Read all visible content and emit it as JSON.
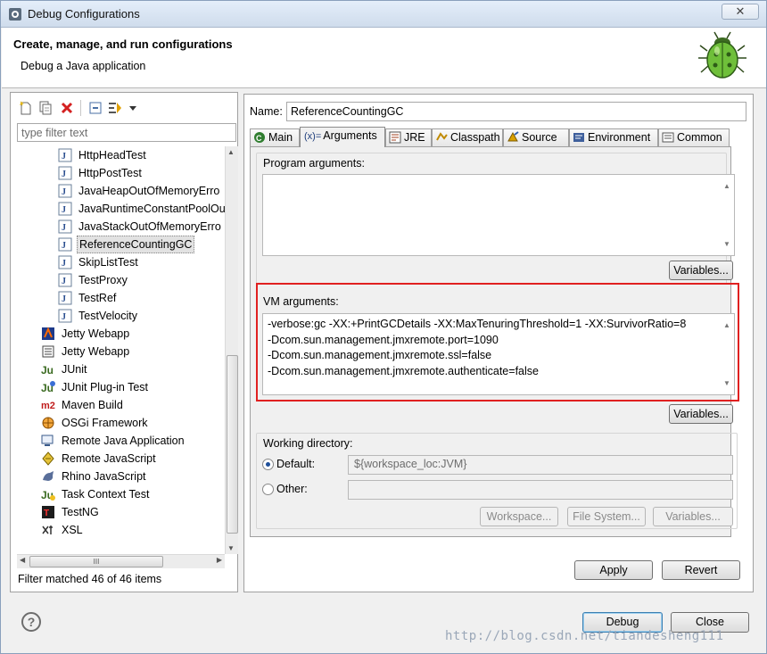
{
  "window": {
    "title": "Debug Configurations",
    "close_label": "✕"
  },
  "header": {
    "title": "Create, manage, and run configurations",
    "subtitle": "Debug a Java application"
  },
  "left": {
    "filter_placeholder": "type filter text",
    "tree": [
      {
        "label": "HttpHeadTest",
        "icon": "java-class-icon",
        "indent": 1
      },
      {
        "label": "HttpPostTest",
        "icon": "java-class-icon",
        "indent": 1
      },
      {
        "label": "JavaHeapOutOfMemoryErro",
        "icon": "java-class-icon",
        "indent": 1
      },
      {
        "label": "JavaRuntimeConstantPoolOu",
        "icon": "java-class-icon",
        "indent": 1
      },
      {
        "label": "JavaStackOutOfMemoryErro",
        "icon": "java-class-icon",
        "indent": 1
      },
      {
        "label": "ReferenceCountingGC",
        "icon": "java-class-icon",
        "indent": 1,
        "selected": true
      },
      {
        "label": "SkipListTest",
        "icon": "java-class-icon",
        "indent": 1
      },
      {
        "label": "TestProxy",
        "icon": "java-class-icon",
        "indent": 1
      },
      {
        "label": "TestRef",
        "icon": "java-class-icon",
        "indent": 1
      },
      {
        "label": "TestVelocity",
        "icon": "java-class-icon",
        "indent": 1
      },
      {
        "label": "Jetty Webapp",
        "icon": "jetty-icon",
        "indent": 0
      },
      {
        "label": "Jetty Webapp",
        "icon": "jetty-alt-icon",
        "indent": 0
      },
      {
        "label": "JUnit",
        "icon": "junit-icon",
        "indent": 0
      },
      {
        "label": "JUnit Plug-in Test",
        "icon": "junit-plugin-icon",
        "indent": 0
      },
      {
        "label": "Maven Build",
        "icon": "maven-icon",
        "indent": 0
      },
      {
        "label": "OSGi Framework",
        "icon": "osgi-icon",
        "indent": 0
      },
      {
        "label": "Remote Java Application",
        "icon": "remote-java-icon",
        "indent": 0
      },
      {
        "label": "Remote JavaScript",
        "icon": "remote-javascript-icon",
        "indent": 0
      },
      {
        "label": "Rhino JavaScript",
        "icon": "rhino-icon",
        "indent": 0
      },
      {
        "label": "Task Context Test",
        "icon": "task-context-icon",
        "indent": 0
      },
      {
        "label": "TestNG",
        "icon": "testng-icon",
        "indent": 0
      },
      {
        "label": "XSL",
        "icon": "xsl-icon",
        "indent": 0
      }
    ],
    "hscroll_grip": "III",
    "filter_status": "Filter matched 46 of 46 items"
  },
  "right": {
    "name_label": "Name:",
    "name_value": "ReferenceCountingGC",
    "tabs": [
      {
        "label": "Main",
        "icon": "main-tab-icon"
      },
      {
        "label": "Arguments",
        "icon": "arguments-tab-icon",
        "prefix": "(x)=",
        "active": true
      },
      {
        "label": "JRE",
        "icon": "jre-tab-icon"
      },
      {
        "label": "Classpath",
        "icon": "classpath-tab-icon"
      },
      {
        "label": "Source",
        "icon": "source-tab-icon"
      },
      {
        "label": "Environment",
        "icon": "environment-tab-icon"
      },
      {
        "label": "Common",
        "icon": "common-tab-icon"
      }
    ],
    "program_args": {
      "label": "Program arguments:",
      "value": "",
      "variables_label": "Variables..."
    },
    "vm_args": {
      "label": "VM arguments:",
      "lines": [
        "-verbose:gc -XX:+PrintGCDetails -XX:MaxTenuringThreshold=1 -XX:SurvivorRatio=8",
        "-Dcom.sun.management.jmxremote.port=1090",
        "-Dcom.sun.management.jmxremote.ssl=false",
        "-Dcom.sun.management.jmxremote.authenticate=false"
      ],
      "variables_label": "Variables..."
    },
    "working_dir": {
      "label": "Working directory:",
      "default_label": "Default:",
      "default_value": "${workspace_loc:JVM}",
      "other_label": "Other:",
      "other_value": "",
      "workspace_label": "Workspace...",
      "filesystem_label": "File System...",
      "variables_label": "Variables..."
    },
    "apply_label": "Apply",
    "revert_label": "Revert"
  },
  "footer": {
    "help_label": "?",
    "debug_label": "Debug",
    "close_label": "Close",
    "watermark": "http://blog.csdn.net/tiandesheng111"
  },
  "colors": {
    "highlight": "#e02020",
    "selection": "#e2e2e2"
  }
}
